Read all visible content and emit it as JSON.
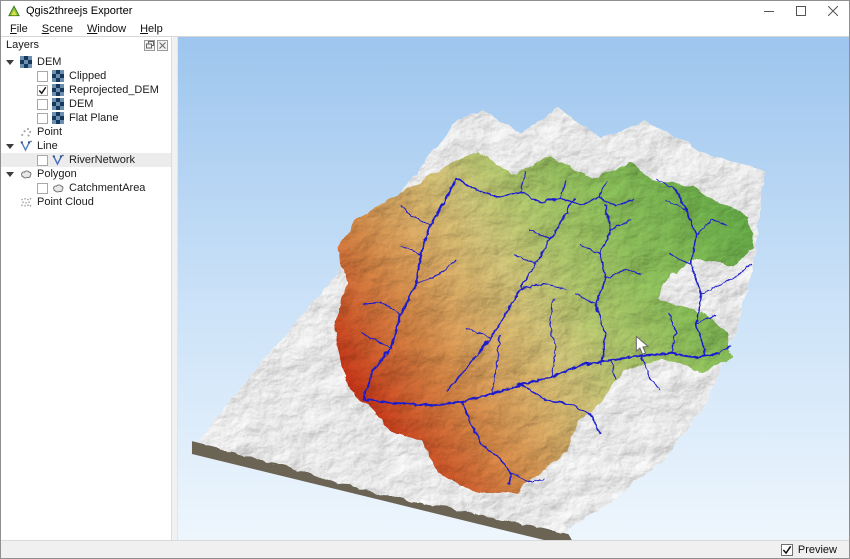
{
  "window": {
    "title": "Qgis2threejs Exporter"
  },
  "menu": {
    "items": [
      {
        "label": "File"
      },
      {
        "label": "Scene"
      },
      {
        "label": "Window"
      },
      {
        "label": "Help"
      }
    ]
  },
  "layers_panel": {
    "title": "Layers",
    "items": [
      {
        "label": "DEM",
        "level": 0,
        "type": "raster-group",
        "expanded": true
      },
      {
        "label": "Clipped",
        "level": 1,
        "type": "raster",
        "checked": false
      },
      {
        "label": "Reprojected_DEM",
        "level": 1,
        "type": "raster",
        "checked": true
      },
      {
        "label": "DEM",
        "level": 1,
        "type": "raster",
        "checked": false
      },
      {
        "label": "Flat Plane",
        "level": 1,
        "type": "raster",
        "checked": false
      },
      {
        "label": "Point",
        "level": 0,
        "type": "point-group"
      },
      {
        "label": "Line",
        "level": 0,
        "type": "line-group",
        "expanded": true
      },
      {
        "label": "RiverNetwork",
        "level": 1,
        "type": "line",
        "checked": false,
        "selected": true
      },
      {
        "label": "Polygon",
        "level": 0,
        "type": "polygon-group",
        "expanded": true
      },
      {
        "label": "CatchmentArea",
        "level": 1,
        "type": "polygon",
        "checked": false
      },
      {
        "label": "Point Cloud",
        "level": 0,
        "type": "pointcloud-group"
      }
    ]
  },
  "statusbar": {
    "preview_label": "Preview",
    "preview_checked": true
  },
  "viewport": {
    "description": "3D DEM preview with elevation-colored catchment and river network",
    "colors": {
      "sky_top": "#9dc5ee",
      "sky_bottom": "#eef6fd",
      "terrain": "#fbfbfb",
      "base_side": "#6b6354",
      "river": "#1d1dcc",
      "elevation_low": "#cc2510",
      "elevation_mid": "#e2b269",
      "elevation_high": "#6db54d"
    }
  }
}
